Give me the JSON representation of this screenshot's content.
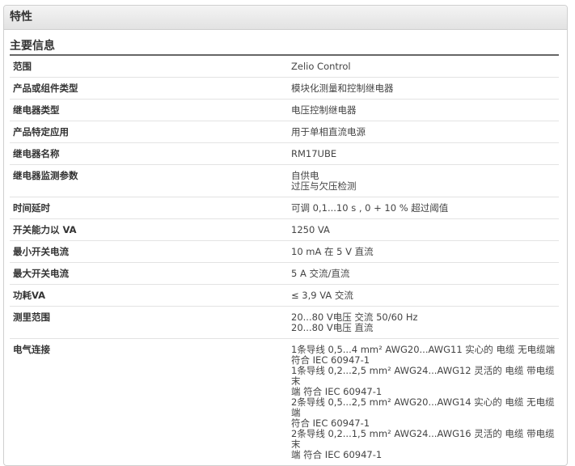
{
  "header": {
    "title": "特性"
  },
  "section": {
    "title": "主要信息"
  },
  "rows": [
    {
      "label": "范围",
      "values": [
        "Zelio Control"
      ]
    },
    {
      "label": "产品或组件类型",
      "values": [
        "模块化测量和控制继电器"
      ]
    },
    {
      "label": "继电器类型",
      "values": [
        "电压控制继电器"
      ]
    },
    {
      "label": "产品特定应用",
      "values": [
        "用于单相直流电源"
      ]
    },
    {
      "label": "继电器名称",
      "values": [
        "RM17UBE"
      ]
    },
    {
      "label": "继电器监测参数",
      "values": [
        "自供电",
        "过压与欠压检测"
      ]
    },
    {
      "label": "时间延时",
      "values": [
        "可调 0,1...10 s , 0 + 10 % 超过阈值"
      ]
    },
    {
      "label": "开关能力以 VA",
      "values": [
        "1250 VA"
      ]
    },
    {
      "label": "最小开关电流",
      "values": [
        "10 mA 在 5 V 直流"
      ]
    },
    {
      "label": "最大开关电流",
      "values": [
        "5 A 交流/直流"
      ]
    },
    {
      "label": "功耗VA",
      "values": [
        "≤ 3,9 VA 交流"
      ]
    },
    {
      "label": "测里范围",
      "values": [
        "20...80 V电压 交流 50/60 Hz",
        "20...80 V电压 直流"
      ]
    },
    {
      "label": "电气连接",
      "values": [
        "1条导线 0,5...4 mm² AWG20...AWG11 实心的 电缆 无电缆端",
        "符合 IEC 60947-1",
        "1条导线 0,2...2,5 mm² AWG24...AWG12 灵活的 电缆 带电缆末",
        "端 符合 IEC 60947-1",
        "2条导线 0,5...2,5 mm² AWG20...AWG14 实心的 电缆 无电缆端",
        "符合 IEC 60947-1",
        "2条导线 0,2...1,5 mm² AWG24...AWG16 灵活的 电缆 带电缆末",
        "端 符合 IEC 60947-1"
      ]
    }
  ]
}
